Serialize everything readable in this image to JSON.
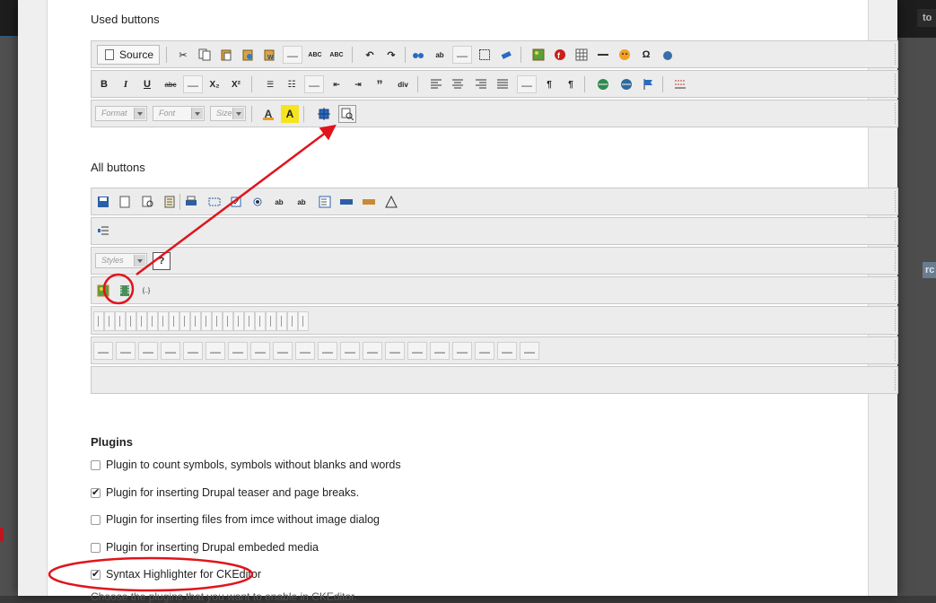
{
  "sections": {
    "used_buttons": "Used buttons",
    "all_buttons": "All buttons",
    "plugins": "Plugins"
  },
  "toolbar": {
    "source_label": "Source",
    "dash": "—",
    "format_placeholder": "Format",
    "font_placeholder": "Font",
    "size_placeholder": "Size",
    "styles_placeholder": "Styles",
    "subscript": "X₂",
    "superscript": "X²",
    "bold": "B",
    "italic": "I",
    "underline": "U",
    "strike": "abc",
    "abc": "ABC"
  },
  "plugins": [
    {
      "label": "Plugin to count symbols, symbols without blanks and words",
      "checked": false
    },
    {
      "label": "Plugin for inserting Drupal teaser and page breaks.",
      "checked": true
    },
    {
      "label": "Plugin for inserting files from imce without image dialog",
      "checked": false
    },
    {
      "label": "Plugin for inserting Drupal embeded media",
      "checked": false
    },
    {
      "label": "Syntax Highlighter for CKEditor",
      "checked": true
    }
  ],
  "footer_cutoff": "Choose the plugins that you want to enable in CKEditor.",
  "background": {
    "top_right_fragment": "to",
    "right_fragment": "rc"
  },
  "colors": {
    "annotation_red": "#e0141c",
    "toolbar_bg": "#ececec",
    "dialog_bg": "#ffffff"
  }
}
